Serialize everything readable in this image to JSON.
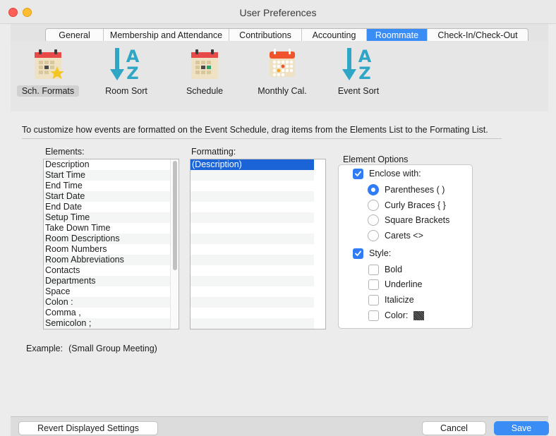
{
  "window": {
    "title": "User Preferences"
  },
  "tabs": [
    {
      "label": "General",
      "active": false
    },
    {
      "label": "Membership and Attendance",
      "active": false
    },
    {
      "label": "Contributions",
      "active": false
    },
    {
      "label": "Accounting",
      "active": false
    },
    {
      "label": "Roommate",
      "active": true
    },
    {
      "label": "Check-In/Check-Out",
      "active": false
    }
  ],
  "toolbar": [
    {
      "label": "Sch. Formats",
      "icon": "calendar-star-icon",
      "selected": true
    },
    {
      "label": "Room Sort",
      "icon": "sort-a-z-icon",
      "selected": false
    },
    {
      "label": "Schedule",
      "icon": "calendar-schedule-icon",
      "selected": false
    },
    {
      "label": "Monthly Cal.",
      "icon": "monthly-calendar-icon",
      "selected": false
    },
    {
      "label": "Event Sort",
      "icon": "sort-a-z-icon",
      "selected": false
    }
  ],
  "instructions": "To customize how events are formatted on the Event Schedule, drag items from the Elements List to the Formating List.",
  "elements": {
    "header": "Elements:",
    "items": [
      "Description",
      "Start Time",
      "End Time",
      "Start Date",
      "End Date",
      "Setup Time",
      "Take Down Time",
      "Room Descriptions",
      "Room Numbers",
      "Room Abbreviations",
      "Contacts",
      "Departments",
      "Space",
      "Colon :",
      "Comma ,",
      "Semicolon ;"
    ]
  },
  "formatting": {
    "header": "Formatting:",
    "items": [
      "(Description)"
    ],
    "selected_index": 0
  },
  "element_options": {
    "header": "Element Options",
    "enclose_with": {
      "label": "Enclose with:",
      "checked": true
    },
    "enclose_choices": [
      {
        "label": "Parentheses ( )",
        "selected": true
      },
      {
        "label": "Curly Braces { }",
        "selected": false
      },
      {
        "label": "Square Brackets",
        "selected": false
      },
      {
        "label": "Carets <>",
        "selected": false
      }
    ],
    "style": {
      "label": "Style:",
      "checked": true
    },
    "style_choices": [
      {
        "label": "Bold",
        "checked": false
      },
      {
        "label": "Underline",
        "checked": false
      },
      {
        "label": "Italicize",
        "checked": false
      },
      {
        "label": "Color:",
        "checked": false
      }
    ]
  },
  "example": {
    "label": "Example:",
    "value": "(Small Group Meeting)"
  },
  "buttons": {
    "revert": "Revert Displayed Settings",
    "cancel": "Cancel",
    "save": "Save"
  },
  "colors": {
    "accent": "#3b8df6",
    "selection": "#1a64d7",
    "calendar_red": "#e84a4a",
    "arrow_teal": "#2fa6c6"
  }
}
